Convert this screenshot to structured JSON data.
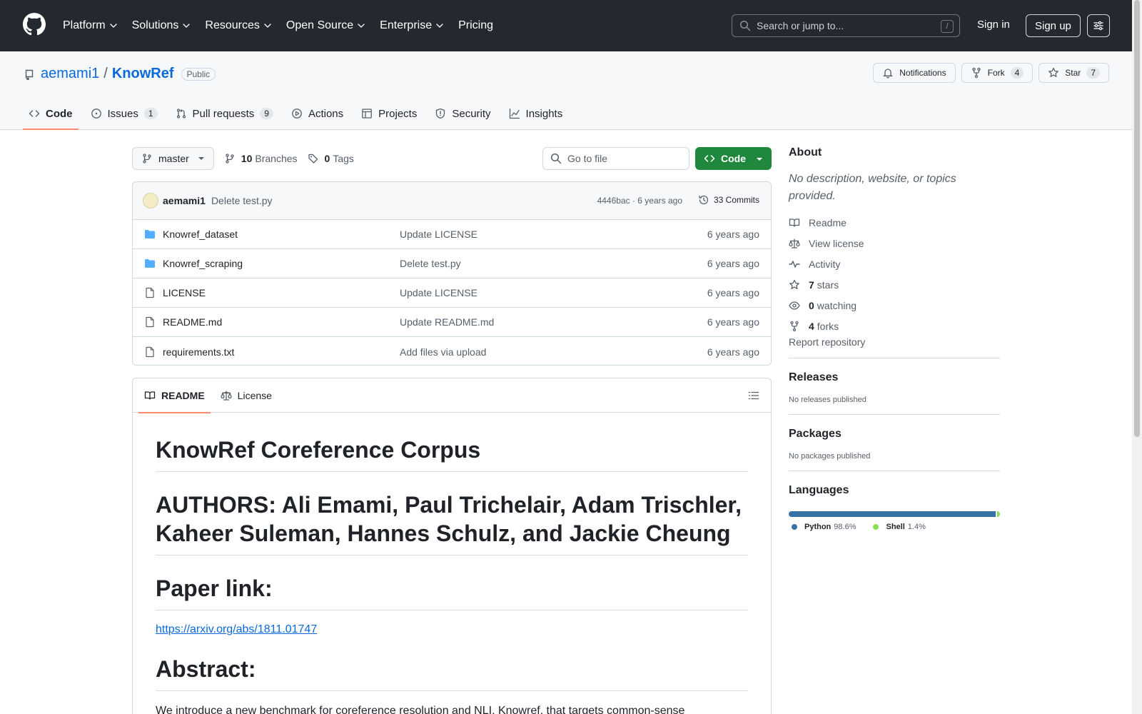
{
  "colors": {
    "header_bg": "#24292f",
    "accent_green": "#1f883d",
    "link_blue": "#0969da",
    "tab_underline": "#fd8c73",
    "python": "#3572A5",
    "shell": "#89e051"
  },
  "header": {
    "nav": [
      "Platform",
      "Solutions",
      "Resources",
      "Open Source",
      "Enterprise",
      "Pricing"
    ],
    "search_placeholder": "Search or jump to...",
    "search_key": "/",
    "signin": "Sign in",
    "signup": "Sign up"
  },
  "repo": {
    "owner": "aemami1",
    "separator": "/",
    "name": "KnowRef",
    "visibility": "Public",
    "actions": {
      "notifications": "Notifications",
      "fork": "Fork",
      "fork_count": "4",
      "star": "Star",
      "star_count": "7"
    },
    "tabs": [
      {
        "label": "Code",
        "count": ""
      },
      {
        "label": "Issues",
        "count": "1"
      },
      {
        "label": "Pull requests",
        "count": "9"
      },
      {
        "label": "Actions",
        "count": ""
      },
      {
        "label": "Projects",
        "count": ""
      },
      {
        "label": "Security",
        "count": ""
      },
      {
        "label": "Insights",
        "count": ""
      }
    ]
  },
  "file_nav": {
    "branch": "master",
    "branches_count": "10",
    "branches_label": "Branches",
    "tags_count": "0",
    "tags_label": "Tags",
    "goto_placeholder": "Go to file",
    "code_button": "Code"
  },
  "latest_commit": {
    "author": "aemami1",
    "message": "Delete test.py",
    "meta": "4446bac · 6 years ago",
    "commits": "33 Commits"
  },
  "files": [
    {
      "name": "Knowref_dataset",
      "type": "folder",
      "commit": "Update LICENSE",
      "age": "6 years ago"
    },
    {
      "name": "Knowref_scraping",
      "type": "folder",
      "commit": "Delete test.py",
      "age": "6 years ago"
    },
    {
      "name": "LICENSE",
      "type": "file",
      "commit": "Update LICENSE",
      "age": "6 years ago"
    },
    {
      "name": "README.md",
      "type": "file",
      "commit": "Update README.md",
      "age": "6 years ago"
    },
    {
      "name": "requirements.txt",
      "type": "file",
      "commit": "Add files via upload",
      "age": "6 years ago"
    }
  ],
  "readme": {
    "tabs": [
      "README",
      "License"
    ],
    "h1": "KnowRef Coreference Corpus",
    "h2": "AUTHORS: Ali Emami, Paul Trichelair, Adam Trischler, Kaheer Suleman, Hannes Schulz, and Jackie Cheung",
    "h3": "Paper link:",
    "link": "https://arxiv.org/abs/1811.01747",
    "h4": "Abstract:",
    "paragraph": "We introduce a new benchmark for coreference resolution and NLI, Knowref, that targets common-sense"
  },
  "sidebar": {
    "about_title": "About",
    "description": "No description, website, or topics provided.",
    "items": [
      {
        "icon": "book-icon",
        "strong": "",
        "label": "Readme"
      },
      {
        "icon": "law-icon",
        "strong": "",
        "label": "View license"
      },
      {
        "icon": "pulse-icon",
        "strong": "",
        "label": "Activity"
      },
      {
        "icon": "star-icon",
        "strong": "7",
        "label": "stars"
      },
      {
        "icon": "eye-icon",
        "strong": "0",
        "label": "watching"
      },
      {
        "icon": "fork-icon",
        "strong": "4",
        "label": "forks"
      }
    ],
    "report": "Report repository",
    "releases_title": "Releases",
    "releases_text": "No releases published",
    "packages_title": "Packages",
    "packages_text": "No packages published",
    "languages_title": "Languages",
    "languages": [
      {
        "name": "Python",
        "percent": "98.6%",
        "value": 98.6,
        "color": "#3572A5"
      },
      {
        "name": "Shell",
        "percent": "1.4%",
        "value": 1.4,
        "color": "#89e051"
      }
    ]
  }
}
